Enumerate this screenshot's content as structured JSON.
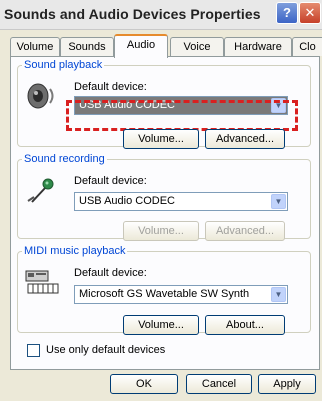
{
  "window": {
    "title": "Sounds and Audio Devices Properties",
    "help_glyph": "?",
    "close_glyph": "✕"
  },
  "tabs": [
    {
      "label": "Volume"
    },
    {
      "label": "Sounds"
    },
    {
      "label": "Audio",
      "active": true
    },
    {
      "label": "Voice"
    },
    {
      "label": "Hardware"
    },
    {
      "label": "Clo"
    }
  ],
  "playback": {
    "title": "Sound playback",
    "default_label": "Default device:",
    "device": "USB Audio CODEC",
    "volume_button": "Volume...",
    "advanced_button": "Advanced..."
  },
  "recording": {
    "title": "Sound recording",
    "default_label": "Default device:",
    "device": "USB Audio CODEC",
    "volume_button": "Volume...",
    "advanced_button": "Advanced..."
  },
  "midi": {
    "title": "MIDI music playback",
    "default_label": "Default device:",
    "device": "Microsoft GS Wavetable SW Synth",
    "volume_button": "Volume...",
    "about_button": "About..."
  },
  "options": {
    "use_default_label": "Use only default devices",
    "use_default_checked": false
  },
  "footer": {
    "ok": "OK",
    "cancel": "Cancel",
    "apply": "Apply"
  },
  "colors": {
    "highlight": "#d92020",
    "group_title": "#0046d5",
    "active_tab_accent": "#e68b2c"
  }
}
